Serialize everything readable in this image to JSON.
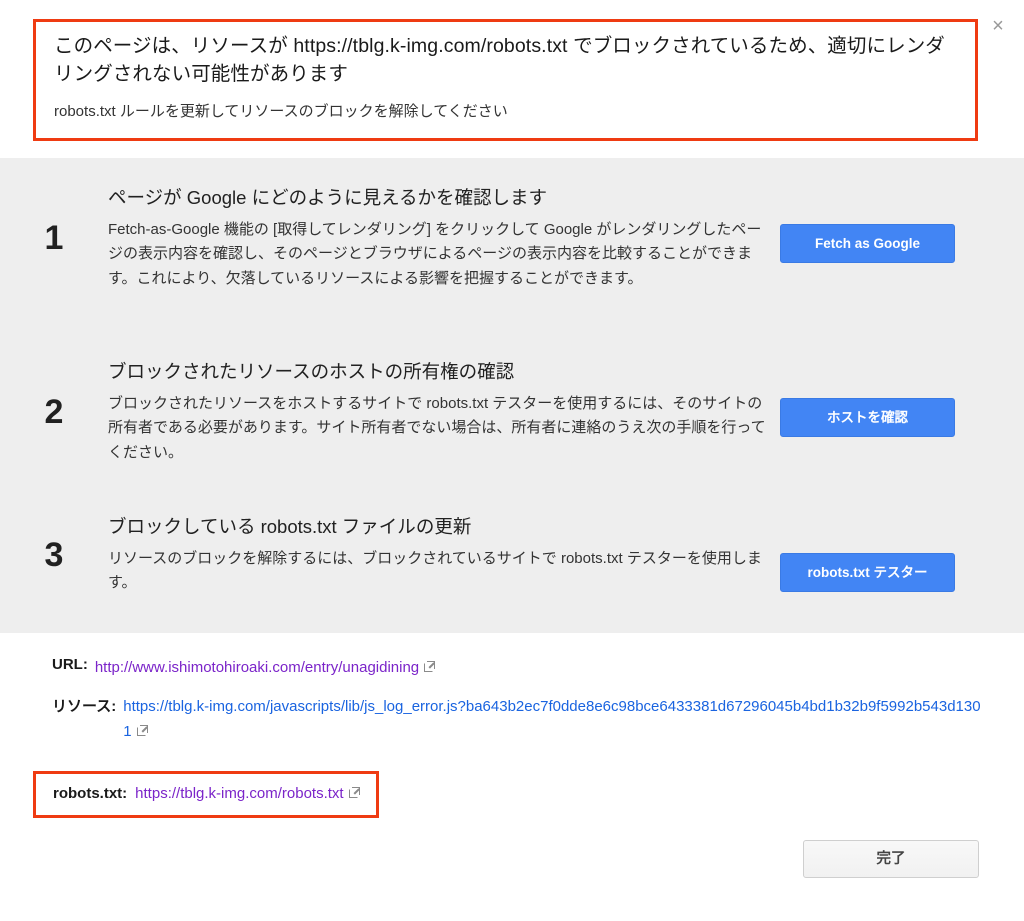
{
  "close_label": "×",
  "warning": {
    "title": "このページは、リソースが https://tblg.k-img.com/robots.txt でブロックされているため、適切にレンダリングされない可能性があります",
    "subtitle": "robots.txt ルールを更新してリソースのブロックを解除してください",
    "border_color": "#ef3b12"
  },
  "steps": [
    {
      "number": "1",
      "heading": "ページが Google にどのように見えるかを確認します",
      "text": "Fetch-as-Google 機能の [取得してレンダリング] をクリックして Google がレンダリングしたページの表示内容を確認し、そのページとブラウザによるページの表示内容を比較することができます。これにより、欠落しているリソースによる影響を把握することができます。",
      "button": "Fetch as Google"
    },
    {
      "number": "2",
      "heading": "ブロックされたリソースのホストの所有権の確認",
      "text": "ブロックされたリソースをホストするサイトで robots.txt テスターを使用するには、そのサイトの所有者である必要があります。サイト所有者でない場合は、所有者に連絡のうえ次の手順を行ってください。",
      "button": "ホストを確認"
    },
    {
      "number": "3",
      "heading": "ブロックしている robots.txt ファイルの更新",
      "text": "リソースのブロックを解除するには、ブロックされているサイトで robots.txt テスターを使用します。",
      "button": "robots.txt テスター"
    }
  ],
  "info": {
    "url_label": "URL:",
    "url_value": "http://www.ishimotohiroaki.com/entry/unagidining",
    "resource_label": "リソース:",
    "resource_value": "https://tblg.k-img.com/javascripts/lib/js_log_error.js?ba643b2ec7f0dde8e6c98bce6433381d67296045b4bd1b32b9f5992b543d1301",
    "robots_label": "robots.txt:",
    "robots_value": "https://tblg.k-img.com/robots.txt"
  },
  "footer": {
    "done_label": "完了"
  },
  "colors": {
    "accent_blue": "#4285f4",
    "warning_red": "#ef3b12",
    "link_purple": "#7b24c9",
    "link_blue": "#1a64e0",
    "panel_gray": "#eeeeee"
  }
}
